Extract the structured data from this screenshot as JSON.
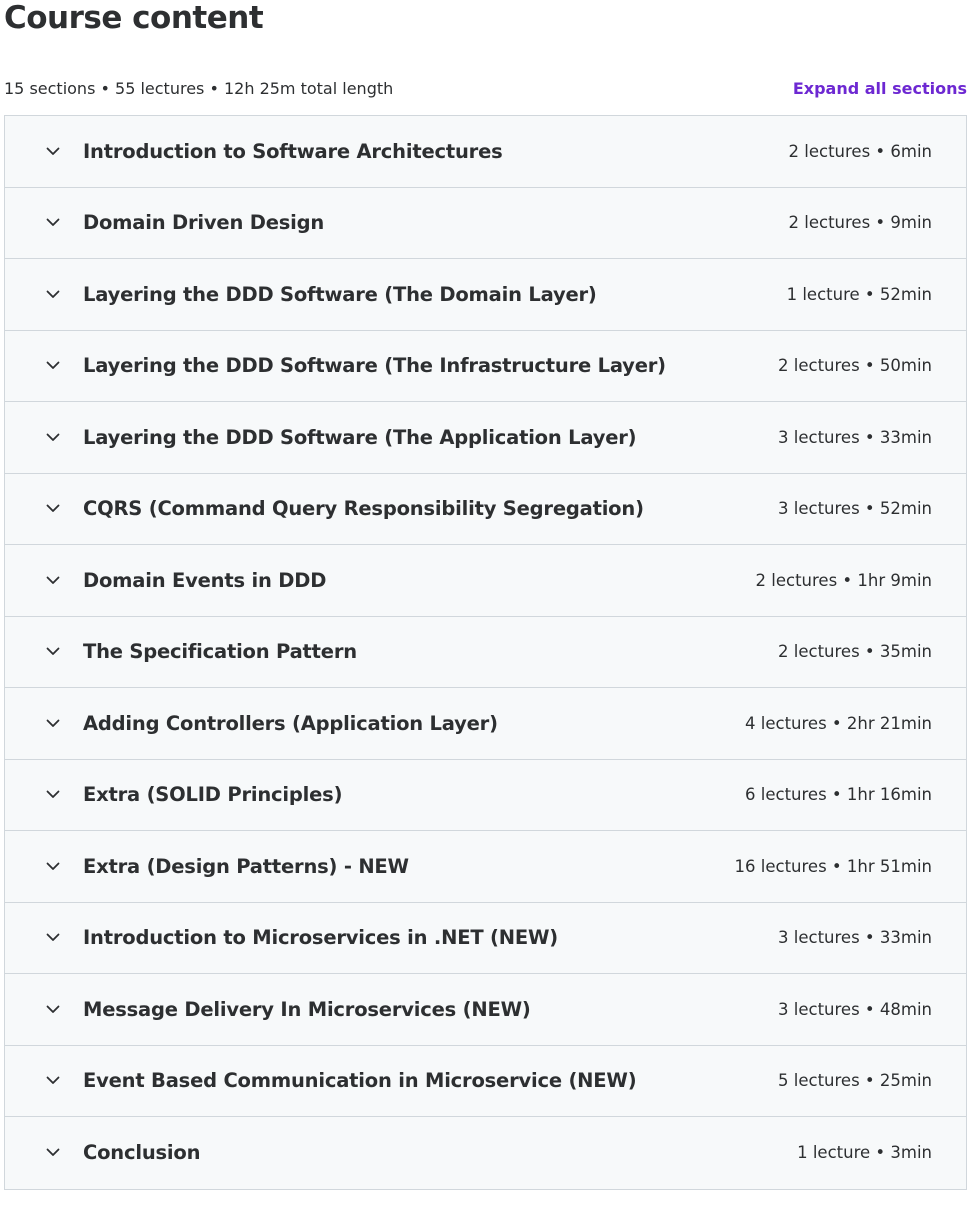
{
  "header": {
    "title": "Course content",
    "summary": "15 sections • 55 lectures • 12h 25m total length",
    "expand_label": "Expand all sections"
  },
  "colors": {
    "accent": "#6d28d2",
    "text": "#2d2f31",
    "section_bg": "#f7f9fa",
    "border": "#d1d7dc"
  },
  "sections": [
    {
      "title": "Introduction to Software Architectures",
      "meta": "2 lectures • 6min",
      "icon": "chevron-down-icon"
    },
    {
      "title": "Domain Driven Design",
      "meta": "2 lectures • 9min",
      "icon": "chevron-down-icon"
    },
    {
      "title": "Layering the DDD Software (The Domain Layer)",
      "meta": "1 lecture • 52min",
      "icon": "chevron-down-icon"
    },
    {
      "title": "Layering the DDD Software (The Infrastructure Layer)",
      "meta": "2 lectures • 50min",
      "icon": "chevron-down-icon"
    },
    {
      "title": "Layering the DDD Software (The Application Layer)",
      "meta": "3 lectures • 33min",
      "icon": "chevron-down-icon"
    },
    {
      "title": "CQRS (Command Query Responsibility Segregation)",
      "meta": "3 lectures • 52min",
      "icon": "chevron-down-icon"
    },
    {
      "title": "Domain Events in DDD",
      "meta": "2 lectures • 1hr 9min",
      "icon": "chevron-down-icon"
    },
    {
      "title": "The Specification Pattern",
      "meta": "2 lectures • 35min",
      "icon": "chevron-down-icon"
    },
    {
      "title": "Adding Controllers (Application Layer)",
      "meta": "4 lectures • 2hr 21min",
      "icon": "chevron-down-icon"
    },
    {
      "title": "Extra (SOLID Principles)",
      "meta": "6 lectures • 1hr 16min",
      "icon": "chevron-down-icon"
    },
    {
      "title": "Extra (Design Patterns) - NEW",
      "meta": "16 lectures • 1hr 51min",
      "icon": "chevron-down-icon"
    },
    {
      "title": "Introduction to Microservices in .NET (NEW)",
      "meta": "3 lectures • 33min",
      "icon": "chevron-down-icon"
    },
    {
      "title": "Message Delivery In Microservices (NEW)",
      "meta": "3 lectures • 48min",
      "icon": "chevron-down-icon"
    },
    {
      "title": "Event Based Communication in Microservice (NEW)",
      "meta": "5 lectures • 25min",
      "icon": "chevron-down-icon"
    },
    {
      "title": "Conclusion",
      "meta": "1 lecture • 3min",
      "icon": "chevron-down-icon"
    }
  ]
}
